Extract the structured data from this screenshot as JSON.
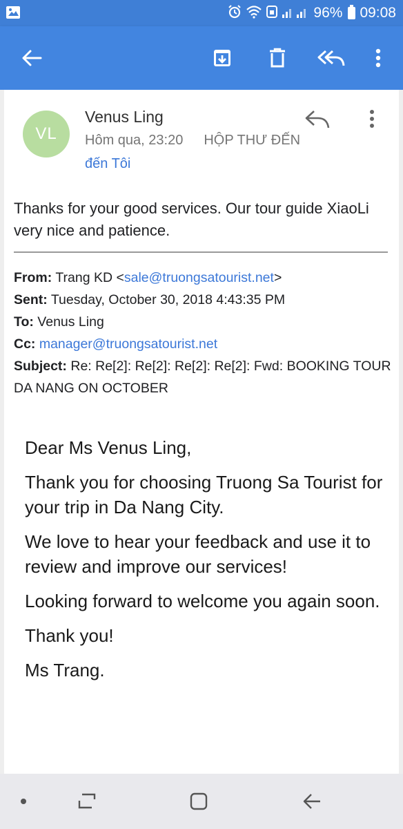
{
  "status_bar": {
    "battery": "96%",
    "time": "09:08",
    "icons": [
      "gallery-icon",
      "alarm-icon",
      "wifi-icon",
      "signal-icon",
      "battery-icon"
    ]
  },
  "toolbar": {
    "icons": [
      "back-arrow-icon",
      "archive-icon",
      "trash-icon",
      "reply-all-icon",
      "more-vert-icon"
    ]
  },
  "message": {
    "avatar_initials": "VL",
    "avatar_color": "#b8dda0",
    "sender": "Venus Ling",
    "date": "Hôm qua, 23:20",
    "folder": "HỘP THƯ ĐẾN",
    "recipient": "đến Tôi",
    "reply_text": "Thanks for your good services. Our tour guide XiaoLi very nice and patience."
  },
  "quoted_header": {
    "from_label": "From:",
    "from_name": "Trang KD <",
    "from_email": "sale@truongsatourist.net",
    "from_close": ">",
    "sent_label": "Sent:",
    "sent_value": "Tuesday, October 30, 2018 4:43:35 PM",
    "to_label": "To:",
    "to_value": "Venus Ling",
    "cc_label": "Cc:",
    "cc_value": "manager@truongsatourist.net",
    "subject_label": "Subject:",
    "subject_value": "Re: Re[2]: Re[2]: Re[2]: Re[2]: Fwd: BOOKING TOUR DA NANG ON OCTOBER"
  },
  "body": {
    "greeting": "Dear Ms Venus Ling,",
    "p1": "Thank you for choosing Truong Sa Tourist for your trip in Da Nang City.",
    "p2": "We love to hear your feedback and use it to review and improve our services!",
    "p3": "Looking forward to welcome you again soon.",
    "p4": "Thank you!",
    "signature": "Ms Trang."
  },
  "colors": {
    "app_bar": "#4285e0",
    "status_bar": "#3f7fd6",
    "link": "#3c78d8"
  },
  "nav_bar": {
    "icons": [
      "dot-icon",
      "recents-icon",
      "home-icon",
      "back-icon"
    ]
  }
}
